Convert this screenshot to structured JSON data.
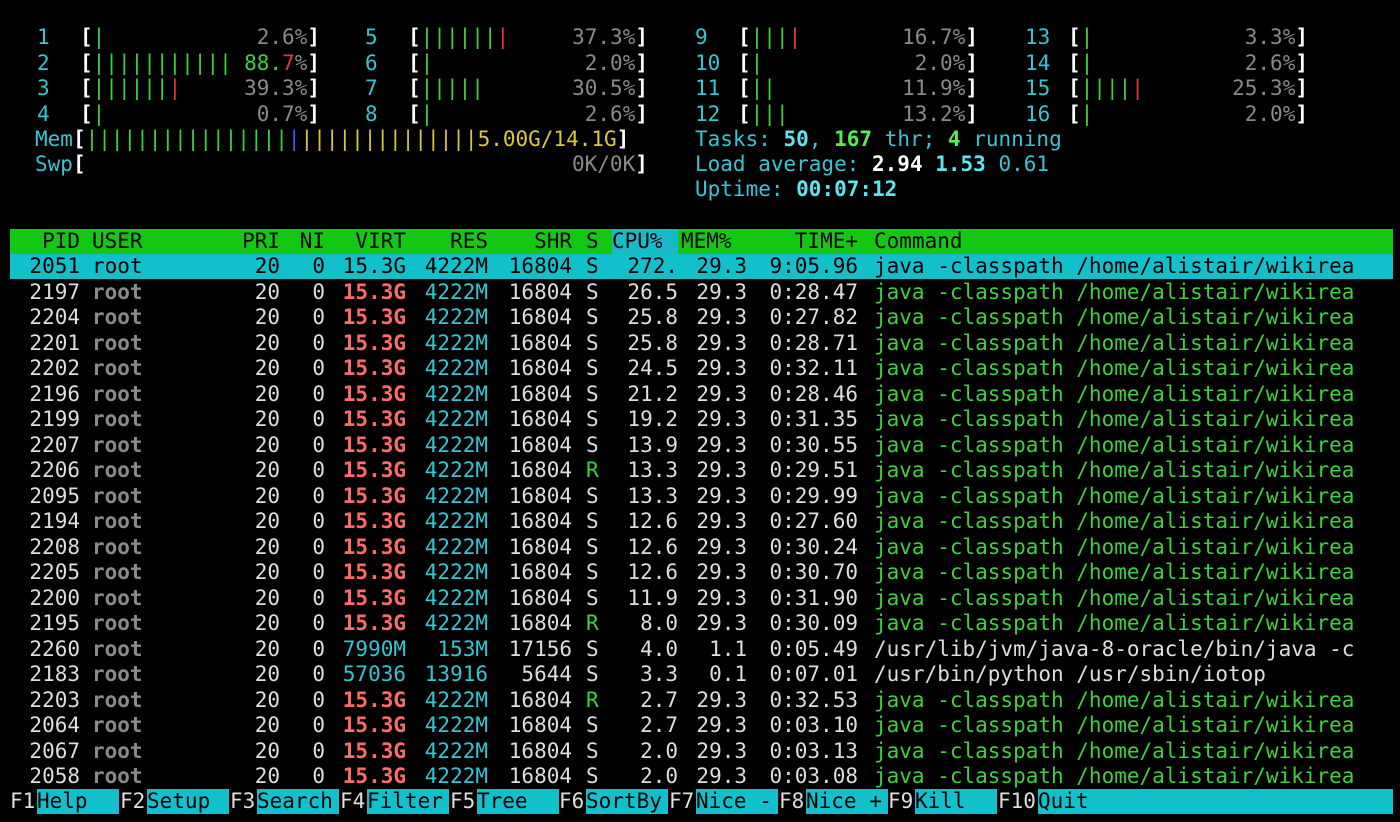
{
  "cpus": [
    {
      "id": "1",
      "pct": "2.6%",
      "green": "|",
      "red": ""
    },
    {
      "id": "2",
      "pct": "88.7%",
      "green": "|||||||||||",
      "red": ""
    },
    {
      "id": "3",
      "pct": "39.3%",
      "green": "||||||",
      "red": "|"
    },
    {
      "id": "4",
      "pct": "0.7%",
      "green": "|",
      "red": ""
    },
    {
      "id": "5",
      "pct": "37.3%",
      "green": "||||||",
      "red": "|"
    },
    {
      "id": "6",
      "pct": "2.0%",
      "green": "|",
      "red": ""
    },
    {
      "id": "7",
      "pct": "30.5%",
      "green": "|||||",
      "red": ""
    },
    {
      "id": "8",
      "pct": "2.6%",
      "green": "|",
      "red": ""
    },
    {
      "id": "9",
      "pct": "16.7%",
      "green": "|||",
      "red": "|"
    },
    {
      "id": "10",
      "pct": "2.0%",
      "green": "|",
      "red": ""
    },
    {
      "id": "11",
      "pct": "11.9%",
      "green": "||",
      "red": ""
    },
    {
      "id": "12",
      "pct": "13.2%",
      "green": "|||",
      "red": ""
    },
    {
      "id": "13",
      "pct": "3.3%",
      "green": "|",
      "red": ""
    },
    {
      "id": "14",
      "pct": "2.6%",
      "green": "|",
      "red": ""
    },
    {
      "id": "15",
      "pct": "25.3%",
      "green": "||||",
      "red": "|"
    },
    {
      "id": "16",
      "pct": "2.0%",
      "green": "|",
      "red": ""
    }
  ],
  "mem": {
    "label": "Mem",
    "green": "||||||||||||||||",
    "blue": "|",
    "yellow": "||||||||||||||",
    "value": "5.00G/14.1G"
  },
  "swp": {
    "label": "Swp",
    "value": "0K/0K"
  },
  "summary": {
    "tasks_label": "Tasks: ",
    "tasks": "50",
    "sep1": ", ",
    "threads": "167",
    "thr_label": " thr; ",
    "running": "4",
    "running_label": " running",
    "load_label": "Load average: ",
    "load1": "2.94",
    "load5": "1.53",
    "load15": "0.61",
    "uptime_label": "Uptime: ",
    "uptime": "00:07:12"
  },
  "columns": {
    "pid": "PID",
    "user": "USER",
    "pri": "PRI",
    "ni": "NI",
    "virt": "VIRT",
    "res": "RES",
    "shr": "SHR",
    "s": "S",
    "cpu": "CPU%",
    "mem": "MEM%",
    "time": "TIME+",
    "command": "Command"
  },
  "processes": [
    {
      "pid": "2051",
      "user": "root",
      "pri": "20",
      "ni": "0",
      "virt": "15.3G",
      "res": "4222M",
      "shr": "16804",
      "s": "S",
      "cpu": "272.",
      "mem": "29.3",
      "time": "9:05.96",
      "command": "java -classpath /home/alistair/wikirea",
      "selected": true
    },
    {
      "pid": "2197",
      "user": "root",
      "pri": "20",
      "ni": "0",
      "virt": "15.3G",
      "res": "4222M",
      "shr": "16804",
      "s": "S",
      "cpu": "26.5",
      "mem": "29.3",
      "time": "0:28.47",
      "command": "java -classpath /home/alistair/wikirea"
    },
    {
      "pid": "2204",
      "user": "root",
      "pri": "20",
      "ni": "0",
      "virt": "15.3G",
      "res": "4222M",
      "shr": "16804",
      "s": "S",
      "cpu": "25.8",
      "mem": "29.3",
      "time": "0:27.82",
      "command": "java -classpath /home/alistair/wikirea"
    },
    {
      "pid": "2201",
      "user": "root",
      "pri": "20",
      "ni": "0",
      "virt": "15.3G",
      "res": "4222M",
      "shr": "16804",
      "s": "S",
      "cpu": "25.8",
      "mem": "29.3",
      "time": "0:28.71",
      "command": "java -classpath /home/alistair/wikirea"
    },
    {
      "pid": "2202",
      "user": "root",
      "pri": "20",
      "ni": "0",
      "virt": "15.3G",
      "res": "4222M",
      "shr": "16804",
      "s": "S",
      "cpu": "24.5",
      "mem": "29.3",
      "time": "0:32.11",
      "command": "java -classpath /home/alistair/wikirea"
    },
    {
      "pid": "2196",
      "user": "root",
      "pri": "20",
      "ni": "0",
      "virt": "15.3G",
      "res": "4222M",
      "shr": "16804",
      "s": "S",
      "cpu": "21.2",
      "mem": "29.3",
      "time": "0:28.46",
      "command": "java -classpath /home/alistair/wikirea"
    },
    {
      "pid": "2199",
      "user": "root",
      "pri": "20",
      "ni": "0",
      "virt": "15.3G",
      "res": "4222M",
      "shr": "16804",
      "s": "S",
      "cpu": "19.2",
      "mem": "29.3",
      "time": "0:31.35",
      "command": "java -classpath /home/alistair/wikirea"
    },
    {
      "pid": "2207",
      "user": "root",
      "pri": "20",
      "ni": "0",
      "virt": "15.3G",
      "res": "4222M",
      "shr": "16804",
      "s": "S",
      "cpu": "13.9",
      "mem": "29.3",
      "time": "0:30.55",
      "command": "java -classpath /home/alistair/wikirea"
    },
    {
      "pid": "2206",
      "user": "root",
      "pri": "20",
      "ni": "0",
      "virt": "15.3G",
      "res": "4222M",
      "shr": "16804",
      "s": "R",
      "cpu": "13.3",
      "mem": "29.3",
      "time": "0:29.51",
      "command": "java -classpath /home/alistair/wikirea"
    },
    {
      "pid": "2095",
      "user": "root",
      "pri": "20",
      "ni": "0",
      "virt": "15.3G",
      "res": "4222M",
      "shr": "16804",
      "s": "S",
      "cpu": "13.3",
      "mem": "29.3",
      "time": "0:29.99",
      "command": "java -classpath /home/alistair/wikirea"
    },
    {
      "pid": "2194",
      "user": "root",
      "pri": "20",
      "ni": "0",
      "virt": "15.3G",
      "res": "4222M",
      "shr": "16804",
      "s": "S",
      "cpu": "12.6",
      "mem": "29.3",
      "time": "0:27.60",
      "command": "java -classpath /home/alistair/wikirea"
    },
    {
      "pid": "2208",
      "user": "root",
      "pri": "20",
      "ni": "0",
      "virt": "15.3G",
      "res": "4222M",
      "shr": "16804",
      "s": "S",
      "cpu": "12.6",
      "mem": "29.3",
      "time": "0:30.24",
      "command": "java -classpath /home/alistair/wikirea"
    },
    {
      "pid": "2205",
      "user": "root",
      "pri": "20",
      "ni": "0",
      "virt": "15.3G",
      "res": "4222M",
      "shr": "16804",
      "s": "S",
      "cpu": "12.6",
      "mem": "29.3",
      "time": "0:30.70",
      "command": "java -classpath /home/alistair/wikirea"
    },
    {
      "pid": "2200",
      "user": "root",
      "pri": "20",
      "ni": "0",
      "virt": "15.3G",
      "res": "4222M",
      "shr": "16804",
      "s": "S",
      "cpu": "11.9",
      "mem": "29.3",
      "time": "0:31.90",
      "command": "java -classpath /home/alistair/wikirea"
    },
    {
      "pid": "2195",
      "user": "root",
      "pri": "20",
      "ni": "0",
      "virt": "15.3G",
      "res": "4222M",
      "shr": "16804",
      "s": "R",
      "cpu": "8.0",
      "mem": "29.3",
      "time": "0:30.09",
      "command": "java -classpath /home/alistair/wikirea"
    },
    {
      "pid": "2260",
      "user": "root",
      "pri": "20",
      "ni": "0",
      "virt": "7990M",
      "res": "153M",
      "shr": "17156",
      "s": "S",
      "cpu": "4.0",
      "mem": "1.1",
      "time": "0:05.49",
      "command": "/usr/lib/jvm/java-8-oracle/bin/java -c"
    },
    {
      "pid": "2183",
      "user": "root",
      "pri": "20",
      "ni": "0",
      "virt": "57036",
      "res": "13916",
      "shr": "5644",
      "s": "S",
      "cpu": "3.3",
      "mem": "0.1",
      "time": "0:07.01",
      "command": "/usr/bin/python /usr/sbin/iotop"
    },
    {
      "pid": "2203",
      "user": "root",
      "pri": "20",
      "ni": "0",
      "virt": "15.3G",
      "res": "4222M",
      "shr": "16804",
      "s": "R",
      "cpu": "2.7",
      "mem": "29.3",
      "time": "0:32.53",
      "command": "java -classpath /home/alistair/wikirea"
    },
    {
      "pid": "2064",
      "user": "root",
      "pri": "20",
      "ni": "0",
      "virt": "15.3G",
      "res": "4222M",
      "shr": "16804",
      "s": "S",
      "cpu": "2.7",
      "mem": "29.3",
      "time": "0:03.10",
      "command": "java -classpath /home/alistair/wikirea"
    },
    {
      "pid": "2067",
      "user": "root",
      "pri": "20",
      "ni": "0",
      "virt": "15.3G",
      "res": "4222M",
      "shr": "16804",
      "s": "S",
      "cpu": "2.0",
      "mem": "29.3",
      "time": "0:03.13",
      "command": "java -classpath /home/alistair/wikirea"
    },
    {
      "pid": "2058",
      "user": "root",
      "pri": "20",
      "ni": "0",
      "virt": "15.3G",
      "res": "4222M",
      "shr": "16804",
      "s": "S",
      "cpu": "2.0",
      "mem": "29.3",
      "time": "0:03.08",
      "command": "java -classpath /home/alistair/wikirea"
    }
  ],
  "fkeys": [
    {
      "key": "F1",
      "label": "Help"
    },
    {
      "key": "F2",
      "label": "Setup"
    },
    {
      "key": "F3",
      "label": "Search"
    },
    {
      "key": "F4",
      "label": "Filter"
    },
    {
      "key": "F5",
      "label": "Tree"
    },
    {
      "key": "F6",
      "label": "SortBy"
    },
    {
      "key": "F7",
      "label": "Nice -"
    },
    {
      "key": "F8",
      "label": "Nice +"
    },
    {
      "key": "F9",
      "label": "Kill"
    },
    {
      "key": "F10",
      "label": "Quit"
    }
  ],
  "colors": {
    "header_bg": "#14c714",
    "selected_bg": "#12c0cc",
    "cyan": "#33c7d4",
    "green": "#3fcf3f",
    "red": "#e23a3a",
    "salmon": "#ff6b6b"
  }
}
